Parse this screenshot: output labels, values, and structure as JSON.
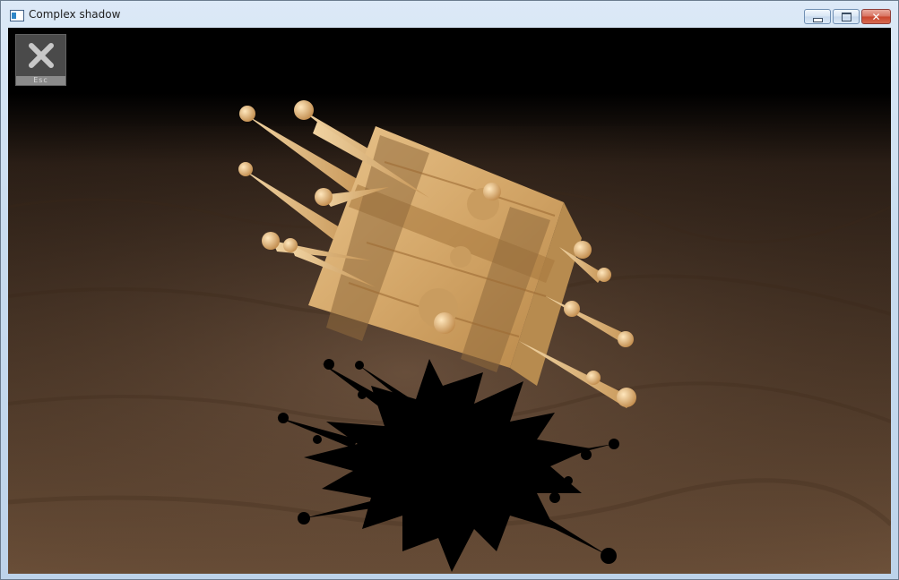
{
  "window": {
    "title": "Complex shadow",
    "controls": {
      "minimize_icon": "minimize-icon",
      "maximize_icon": "maximize-icon",
      "close_icon": "close-icon",
      "close_glyph": "✕"
    }
  },
  "overlay": {
    "esc_label": "Esc",
    "esc_icon": "close-x-icon"
  },
  "colors": {
    "background": "#000000",
    "ground": "#6b4a34",
    "wood": "#d8ad6f",
    "shadow": "#000000",
    "close_button": "#c8432a"
  }
}
